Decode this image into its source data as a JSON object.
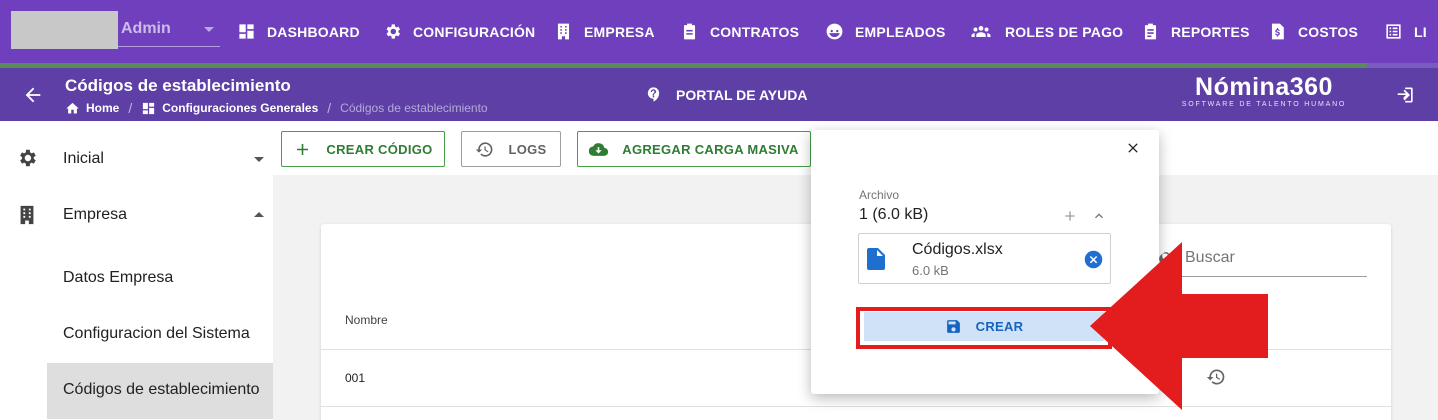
{
  "user": {
    "role": "Admin"
  },
  "nav": {
    "items": [
      {
        "label": "DASHBOARD",
        "icon": "dashboard-icon"
      },
      {
        "label": "CONFIGURACIÓN",
        "icon": "gear-icon"
      },
      {
        "label": "EMPRESA",
        "icon": "building-icon"
      },
      {
        "label": "CONTRATOS",
        "icon": "clipboard-icon"
      },
      {
        "label": "EMPLEADOS",
        "icon": "face-icon"
      },
      {
        "label": "ROLES DE PAGO",
        "icon": "people-icon"
      },
      {
        "label": "REPORTES",
        "icon": "clipboard-list-icon"
      },
      {
        "label": "COSTOS",
        "icon": "dollar-doc-icon"
      },
      {
        "label": "LI",
        "icon": "list-icon"
      }
    ]
  },
  "header": {
    "title": "Códigos de establecimiento",
    "breadcrumb": [
      "Home",
      "Configuraciones Generales",
      "Códigos de establecimiento"
    ],
    "help": "PORTAL DE AYUDA",
    "logo": "Nómina360",
    "logo_tagline": "SOFTWARE DE TALENTO HUMANO"
  },
  "sidebar": {
    "items": [
      {
        "label": "Inicial",
        "icon": "gear-icon"
      },
      {
        "label": "Empresa",
        "icon": "building-icon"
      }
    ],
    "subitems": [
      "Datos Empresa",
      "Configuracion del Sistema",
      "Códigos de establecimiento"
    ]
  },
  "toolbar": {
    "create": "CREAR CÓDIGO",
    "logs": "LOGS",
    "bulk": "AGREGAR CARGA MASIVA"
  },
  "table": {
    "search_placeholder": "Buscar",
    "columns": [
      "Nombre"
    ],
    "rows": [
      [
        "001"
      ]
    ]
  },
  "upload": {
    "label": "Archivo",
    "count": "1 (6.0 kB)",
    "file": {
      "name": "Códigos.xlsx",
      "size": "6.0 kB"
    },
    "submit": "CREAR"
  },
  "colors": {
    "nav_bg": "#6f3fbe",
    "header_bg": "#5d3fa6",
    "green": "#43a047",
    "accent_blue": "#1565c0",
    "highlight_red": "#e31d1d"
  }
}
